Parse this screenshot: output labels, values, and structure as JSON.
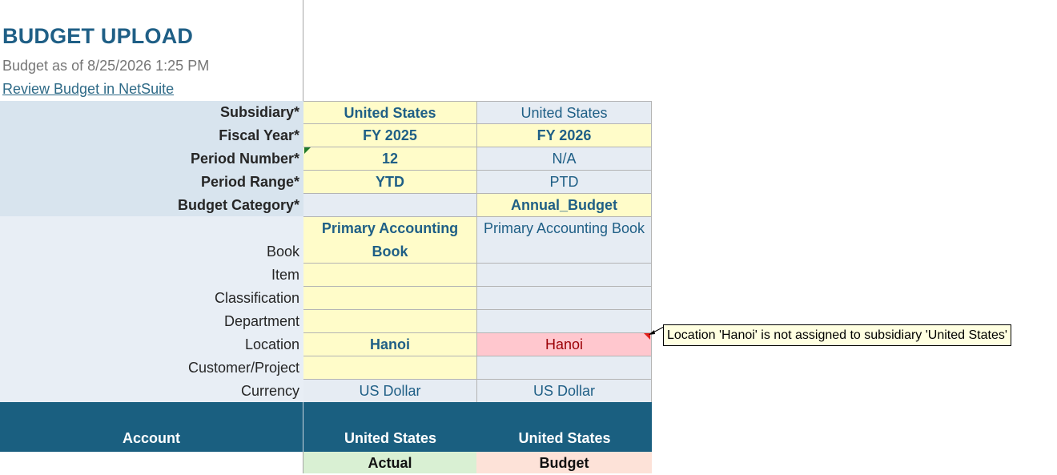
{
  "header": {
    "title": "BUDGET UPLOAD",
    "as_of": "Budget as of 8/25/2026 1:25 PM",
    "link": "Review Budget in NetSuite"
  },
  "params": {
    "subsidiary": {
      "label": "Subsidiary*",
      "col1": "United States",
      "col2": "United States"
    },
    "fiscal_year": {
      "label": "Fiscal Year*",
      "col1": "FY 2025",
      "col2": "FY 2026"
    },
    "period_number": {
      "label": "Period Number*",
      "col1": "12",
      "col2": "N/A"
    },
    "period_range": {
      "label": "Period Range*",
      "col1": "YTD",
      "col2": "PTD"
    },
    "budget_category": {
      "label": "Budget Category*",
      "col1": "",
      "col2": "Annual_Budget"
    },
    "book": {
      "label": "Book",
      "col1": "Primary Accounting Book",
      "col2": "Primary Accounting Book"
    },
    "item": {
      "label": "Item",
      "col1": "",
      "col2": ""
    },
    "classification": {
      "label": "Classification",
      "col1": "",
      "col2": ""
    },
    "department": {
      "label": "Department",
      "col1": "",
      "col2": ""
    },
    "location": {
      "label": "Location",
      "col1": "Hanoi",
      "col2": "Hanoi"
    },
    "customer_project": {
      "label": "Customer/Project",
      "col1": "",
      "col2": ""
    },
    "currency": {
      "label": "Currency",
      "col1": "US Dollar",
      "col2": "US Dollar"
    }
  },
  "table_header": {
    "account": "Account",
    "col1": "United States",
    "col2": "United States",
    "col1_type": "Actual",
    "col2_type": "Budget"
  },
  "comment": "Location 'Hanoi' is not assigned to subsidiary 'United States'",
  "colors": {
    "input_yellow": "#fffcc9",
    "readonly_gray": "#e6ecf3",
    "error_red": "#ffc7ce",
    "header_blue": "#1a5f80",
    "actual_green": "#d9f0d3",
    "budget_peach": "#fde2d8"
  }
}
